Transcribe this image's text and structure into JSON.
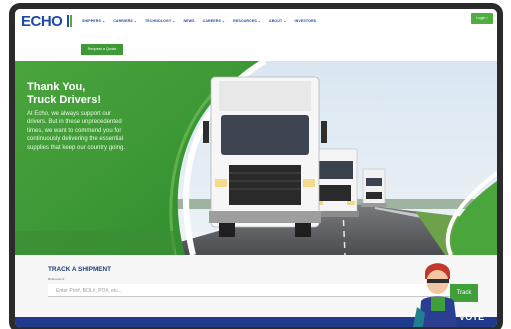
{
  "header": {
    "logo": "ECHO",
    "nav": [
      "SHIPPERS ⌄",
      "CARRIERS ⌄",
      "TECHNOLOGY ⌄",
      "NEWS",
      "CAREERS ⌄",
      "RESOURCES ⌄",
      "ABOUT ⌄",
      "INVESTORS"
    ],
    "login_label": "Login ›",
    "quote_label": "Request a Quote"
  },
  "hero": {
    "title_line1": "Thank You,",
    "title_line2": "Truck Drivers!",
    "body": "At Echo, we always support our drivers. But in these unprecedented times, we want to commend you for continuously delivering the essential supplies that keep our country going."
  },
  "track": {
    "title": "TRACK A SHIPMENT",
    "label": "Reference #",
    "placeholder": "Enter Pro#, BOL#, PO#, etc...",
    "button": "Track"
  },
  "badge": {
    "text": "VOTE"
  },
  "colors": {
    "brand_blue": "#1f4aa6",
    "brand_green": "#4caf3e",
    "footer_navy": "#1f3b8d"
  }
}
